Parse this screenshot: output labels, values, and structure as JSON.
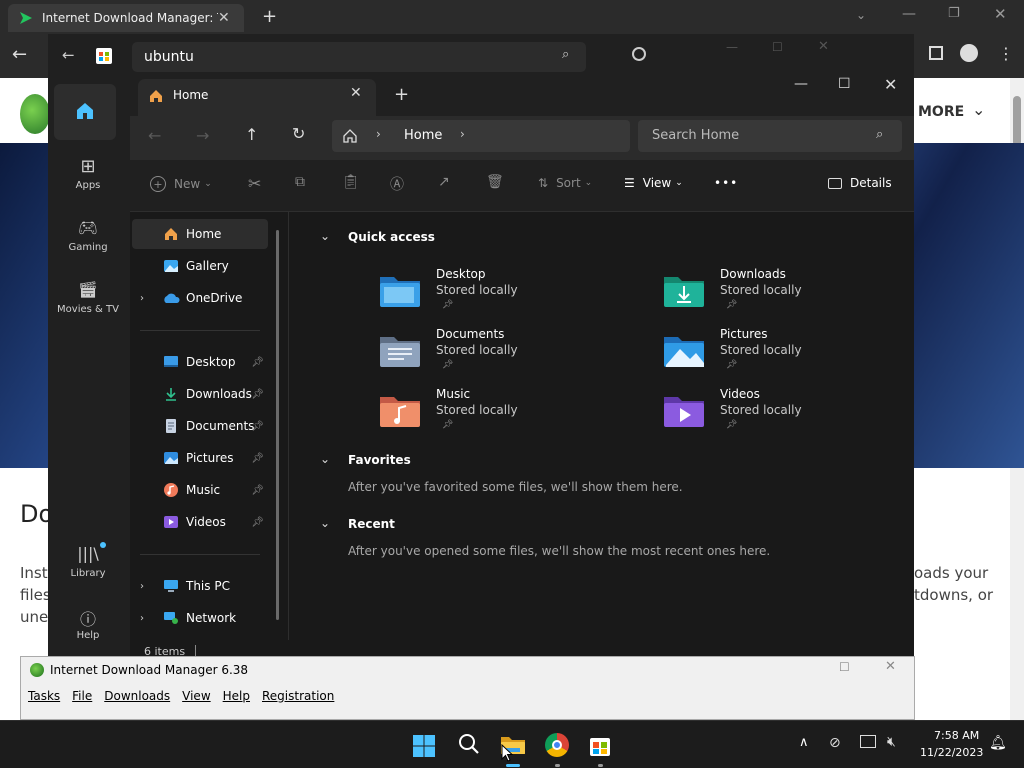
{
  "browser": {
    "tab_title": "Internet Download Manager: The",
    "scrollbar": "scroll"
  },
  "webpage": {
    "more_label": "MORE",
    "heading_fragment": "Do",
    "text_left": [
      "Insta",
      "files",
      "une"
    ],
    "text_right": [
      "oads your",
      "tdowns, or"
    ]
  },
  "store": {
    "search_value": "ubuntu",
    "rail": [
      {
        "label": ""
      },
      {
        "label": "Apps"
      },
      {
        "label": "Gaming"
      },
      {
        "label": "Movies & TV"
      },
      {
        "label": "Library"
      },
      {
        "label": "Help"
      }
    ]
  },
  "explorer": {
    "tab_title": "Home",
    "breadcrumb": "Home",
    "search_placeholder": "Search Home",
    "commands": {
      "new": "New",
      "sort": "Sort",
      "view": "View",
      "more": "•••",
      "details": "Details"
    },
    "nav": {
      "home": "Home",
      "gallery": "Gallery",
      "onedrive": "OneDrive",
      "pinned": [
        "Desktop",
        "Downloads",
        "Documents",
        "Pictures",
        "Music",
        "Videos"
      ],
      "this_pc": "This PC",
      "network": "Network"
    },
    "sections": {
      "quick_access": "Quick access",
      "favorites": "Favorites",
      "favorites_empty": "After you've favorited some files, we'll show them here.",
      "recent": "Recent",
      "recent_empty": "After you've opened some files, we'll show the most recent ones here."
    },
    "quick_access": [
      {
        "name": "Desktop",
        "status": "Stored locally",
        "icon": "desktop-folder-icon",
        "color": "#3aa0e8"
      },
      {
        "name": "Downloads",
        "status": "Stored locally",
        "icon": "downloads-folder-icon",
        "color": "#1fb39a"
      },
      {
        "name": "Documents",
        "status": "Stored locally",
        "icon": "documents-folder-icon",
        "color": "#8fa3bd"
      },
      {
        "name": "Pictures",
        "status": "Stored locally",
        "icon": "pictures-folder-icon",
        "color": "#2f9be6"
      },
      {
        "name": "Music",
        "status": "Stored locally",
        "icon": "music-folder-icon",
        "color": "#f08f6a"
      },
      {
        "name": "Videos",
        "status": "Stored locally",
        "icon": "videos-folder-icon",
        "color": "#8b5be0"
      }
    ],
    "status": "6 items"
  },
  "idm": {
    "title": "Internet Download Manager 6.38",
    "menu": [
      "Tasks",
      "File",
      "Downloads",
      "View",
      "Help",
      "Registration"
    ]
  },
  "taskbar": {
    "time": "7:58 AM",
    "date": "11/22/2023"
  }
}
